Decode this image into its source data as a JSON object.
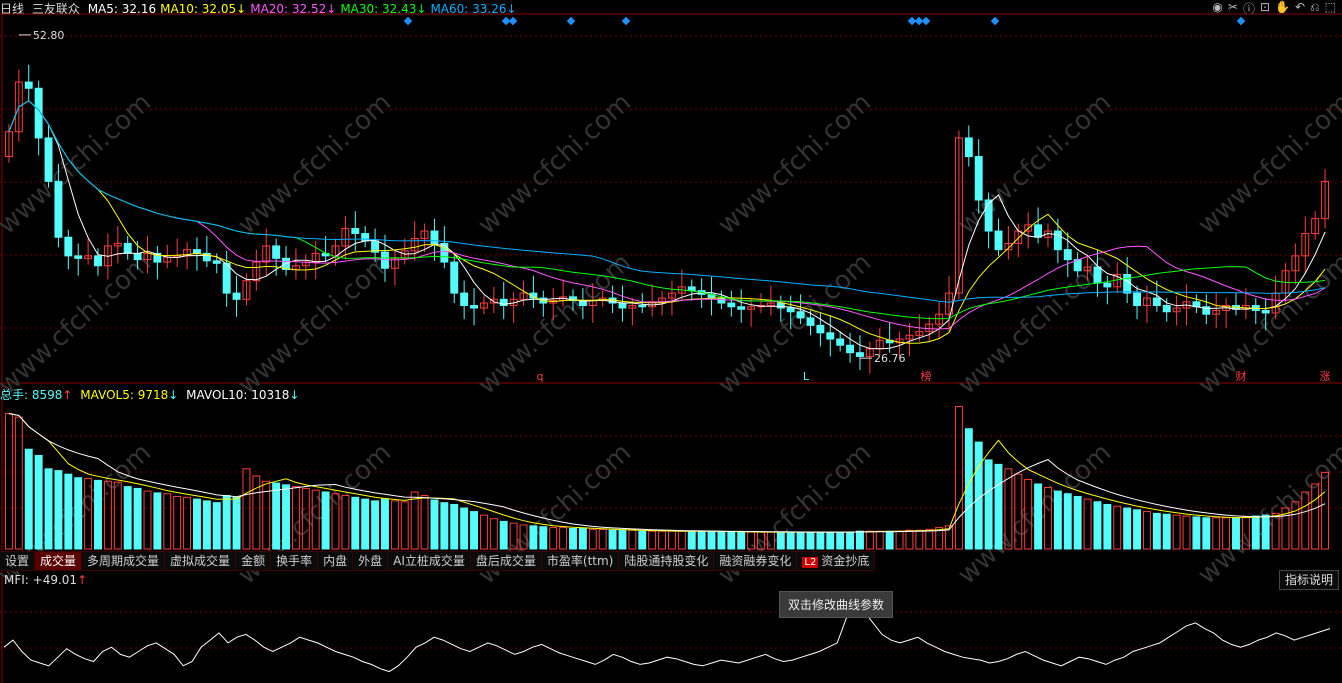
{
  "header": {
    "period": "日线",
    "stock_name": "三友联众",
    "ma": [
      {
        "label": "MA5: 32.16",
        "arrow": "",
        "color": "#ffffff"
      },
      {
        "label": "MA10: 32.05",
        "arrow": "↓",
        "color": "#ffff00"
      },
      {
        "label": "MA20: 32.52",
        "arrow": "↓",
        "color": "#ff55ff"
      },
      {
        "label": "MA30: 32.43",
        "arrow": "↓",
        "color": "#00ff00"
      },
      {
        "label": "MA60: 33.26",
        "arrow": "↓",
        "color": "#00b0ff"
      }
    ]
  },
  "toolbar_icons": [
    "eye-icon",
    "scissors-icon",
    "info-icon",
    "lock-icon",
    "hand-icon",
    "undo-icon",
    "back-icon",
    "fullscreen-icon"
  ],
  "volume_header": {
    "total": "总手: 8598",
    "total_arrow": "↑",
    "mavol5": "MAVOL5: 9718",
    "mavol5_arrow": "↓",
    "mavol10": "MAVOL10: 10318",
    "mavol10_arrow": "↓"
  },
  "tabs": [
    "设置",
    "成交量",
    "多周期成交量",
    "虚拟成交量",
    "金额",
    "换手率",
    "内盘",
    "外盘",
    "AI立桩成交量",
    "盘后成交量",
    "市盈率(ttm)",
    "陆股通持股变化",
    "融资融券变化",
    "资金抄底"
  ],
  "active_tab": "成交量",
  "l2_badge": "L2",
  "mfi": {
    "label": "MFI: +49.01",
    "arrow": "↑"
  },
  "explain_button": "指标说明",
  "tooltip": "双击修改曲线参数",
  "watermark": "www.cfchi.com",
  "colors": {
    "up": "#ff3c3c",
    "down": "#54fcfc",
    "grid": "#6b0000",
    "ma5": "#ffffff",
    "ma10": "#ffff00",
    "ma20": "#ff55ff",
    "ma30": "#00ff00",
    "ma60": "#00b0ff"
  },
  "chart_data": [
    {
      "type": "candlestick",
      "high_label": "52.80",
      "low_label": "26.76",
      "event_markers": [
        "q",
        "L",
        "榜",
        "财",
        "涨"
      ],
      "close_prices": [
        45.0,
        49.0,
        48.5,
        44.5,
        41.0,
        36.5,
        35.0,
        34.8,
        35.0,
        34.2,
        35.8,
        36.0,
        35.2,
        34.7,
        35.2,
        34.5,
        34.9,
        35.0,
        35.5,
        35.2,
        34.6,
        34.4,
        32.0,
        31.5,
        33.0,
        34.5,
        35.8,
        34.8,
        33.9,
        34.2,
        34.5,
        35.2,
        35.0,
        35.8,
        37.2,
        36.8,
        36.2,
        35.3,
        34.0,
        34.8,
        35.4,
        36.4,
        37.0,
        36.0,
        34.5,
        32.0,
        31.0,
        30.8,
        31.2,
        31.5,
        31.0,
        31.5,
        32.0,
        31.6,
        31.2,
        31.4,
        31.7,
        31.4,
        31.0,
        31.4,
        31.6,
        31.2,
        30.8,
        31.0,
        30.9,
        31.3,
        31.6,
        32.0,
        32.5,
        32.2,
        31.9,
        31.6,
        31.2,
        30.9,
        30.7,
        30.9,
        31.0,
        31.2,
        30.8,
        30.5,
        30.0,
        29.4,
        28.8,
        28.3,
        27.8,
        27.2,
        26.9,
        27.5,
        28.2,
        28.0,
        28.3,
        28.6,
        28.9,
        29.5,
        30.3,
        32.0,
        44.5,
        43.0,
        39.5,
        37.0,
        35.5,
        36.0,
        37.0,
        37.5,
        36.5,
        37.0,
        35.5,
        34.7,
        33.8,
        34.1,
        32.8,
        32.5,
        33.5,
        32.0,
        31.0,
        31.6,
        31.0,
        30.5,
        30.8,
        31.3,
        30.9,
        30.3,
        30.6,
        31.0,
        30.7,
        31.0,
        30.6,
        30.4,
        32.0,
        33.8,
        35.0,
        36.8,
        38.0,
        41.0
      ],
      "volume": [
        15200,
        14800,
        11200,
        10500,
        9000,
        8800,
        8400,
        8000,
        7900,
        7700,
        7600,
        7500,
        7000,
        6800,
        6500,
        6300,
        6200,
        5900,
        5800,
        5600,
        5400,
        5200,
        6000,
        5800,
        9000,
        8200,
        7600,
        7400,
        7200,
        7000,
        6800,
        6600,
        6400,
        6200,
        6000,
        5800,
        5600,
        5400,
        5600,
        5400,
        5300,
        6400,
        6000,
        5500,
        5200,
        5000,
        4600,
        4200,
        3800,
        3400,
        3100,
        2900,
        2700,
        2600,
        2500,
        2400,
        2400,
        2300,
        2300,
        2200,
        2200,
        2100,
        2100,
        2100,
        2000,
        2000,
        2000,
        2000,
        2000,
        2000,
        2000,
        2000,
        1900,
        1900,
        1900,
        1900,
        1900,
        1900,
        1900,
        1900,
        1900,
        1900,
        1900,
        1900,
        1900,
        1900,
        2000,
        2000,
        2000,
        2000,
        2000,
        2100,
        2100,
        2200,
        2400,
        2600,
        16000,
        13500,
        12000,
        10000,
        9500,
        9000,
        8400,
        7800,
        7300,
        6900,
        6500,
        6200,
        5900,
        5600,
        5300,
        5000,
        4800,
        4600,
        4400,
        4200,
        4000,
        3900,
        3800,
        3700,
        3600,
        3500,
        3500,
        3500,
        3500,
        3600,
        3700,
        3800,
        4000,
        4600,
        5300,
        6400,
        7300,
        8598
      ],
      "mfi": [
        55,
        60,
        52,
        46,
        44,
        42,
        48,
        54,
        50,
        47,
        45,
        52,
        55,
        50,
        48,
        52,
        56,
        58,
        54,
        50,
        42,
        45,
        55,
        60,
        65,
        58,
        62,
        64,
        60,
        55,
        52,
        55,
        58,
        62,
        60,
        58,
        55,
        52,
        50,
        48,
        45,
        43,
        40,
        38,
        42,
        48,
        55,
        58,
        62,
        60,
        57,
        54,
        52,
        55,
        58,
        56,
        53,
        50,
        52,
        55,
        57,
        54,
        51,
        49,
        47,
        45,
        43,
        46,
        50,
        48,
        45,
        43,
        44,
        46,
        48,
        47,
        45,
        43,
        42,
        44,
        46,
        45,
        44,
        46,
        48,
        50,
        47,
        45,
        46,
        48,
        50,
        52,
        55,
        58,
        75,
        88,
        80,
        72,
        64,
        60,
        58,
        60,
        62,
        58,
        55,
        52,
        50,
        48,
        47,
        46,
        44,
        45,
        47,
        50,
        52,
        49,
        46,
        44,
        42,
        45,
        48,
        47,
        45,
        43,
        46,
        48,
        52,
        54,
        56,
        58,
        62,
        66,
        70,
        72,
        68,
        65,
        60,
        57,
        55,
        57,
        60,
        62,
        65,
        63,
        60,
        62,
        64,
        66,
        68
      ]
    }
  ]
}
